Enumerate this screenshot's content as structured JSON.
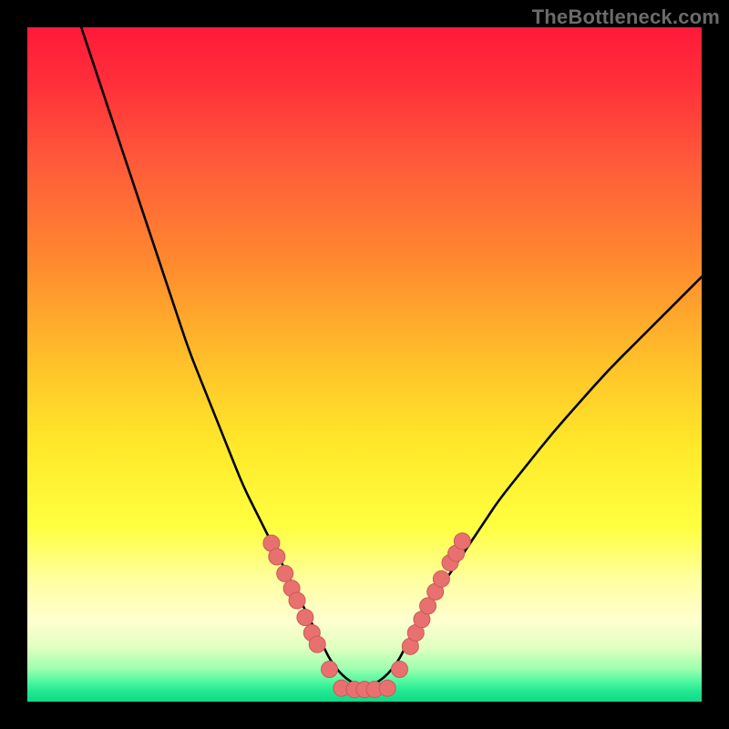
{
  "watermark": "TheBottleneck.com",
  "colors": {
    "background": "#000000",
    "curve": "#000000",
    "dot_fill": "#e8716f",
    "dot_stroke": "#c85a58"
  },
  "chart_data": {
    "type": "line",
    "title": "",
    "xlabel": "",
    "ylabel": "",
    "xlim": [
      0,
      100
    ],
    "ylim": [
      0,
      100
    ],
    "series": [
      {
        "name": "curve",
        "x": [
          8,
          10,
          12,
          14,
          16,
          18,
          20,
          22,
          24,
          26,
          28,
          30,
          32,
          34,
          36,
          38,
          40,
          42,
          43,
          44,
          45,
          47,
          50,
          53,
          55,
          56,
          57,
          58,
          60,
          62,
          64,
          66,
          68,
          70,
          74,
          78,
          82,
          86,
          90,
          94,
          98,
          100
        ],
        "y": [
          100,
          94,
          88,
          82,
          76,
          70,
          64,
          58,
          52,
          47,
          42,
          37,
          32,
          28,
          24,
          20,
          16,
          12,
          10,
          8,
          6,
          3.5,
          1.8,
          3.5,
          6,
          8,
          10,
          12,
          15,
          18,
          21,
          24,
          27,
          30,
          35,
          40,
          44.5,
          49,
          53,
          57,
          61,
          63
        ]
      }
    ],
    "dots": [
      {
        "x": 36.2,
        "y": 23.5
      },
      {
        "x": 37.0,
        "y": 21.5
      },
      {
        "x": 38.2,
        "y": 19.0
      },
      {
        "x": 39.2,
        "y": 16.8
      },
      {
        "x": 40.0,
        "y": 15.0
      },
      {
        "x": 41.2,
        "y": 12.5
      },
      {
        "x": 42.2,
        "y": 10.2
      },
      {
        "x": 43.0,
        "y": 8.5
      },
      {
        "x": 44.8,
        "y": 4.8
      },
      {
        "x": 46.6,
        "y": 2.0
      },
      {
        "x": 48.5,
        "y": 1.8
      },
      {
        "x": 50.0,
        "y": 1.8
      },
      {
        "x": 51.5,
        "y": 1.8
      },
      {
        "x": 53.4,
        "y": 2.0
      },
      {
        "x": 55.2,
        "y": 4.8
      },
      {
        "x": 56.8,
        "y": 8.2
      },
      {
        "x": 57.6,
        "y": 10.2
      },
      {
        "x": 58.5,
        "y": 12.2
      },
      {
        "x": 59.4,
        "y": 14.2
      },
      {
        "x": 60.5,
        "y": 16.3
      },
      {
        "x": 61.4,
        "y": 18.2
      },
      {
        "x": 62.7,
        "y": 20.6
      },
      {
        "x": 63.6,
        "y": 22.0
      },
      {
        "x": 64.5,
        "y": 23.8
      }
    ]
  }
}
